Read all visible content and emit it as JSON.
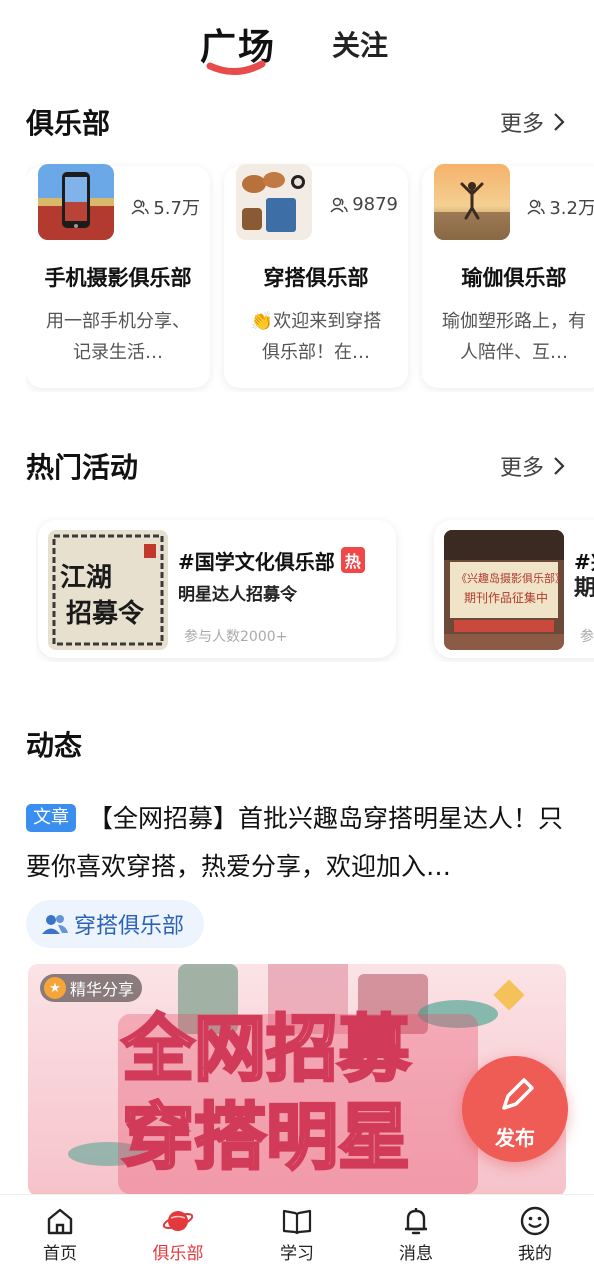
{
  "top_tabs": {
    "active": "广场",
    "other": "关注"
  },
  "clubs_section": {
    "title": "俱乐部",
    "more_label": "更多",
    "cards": [
      {
        "name": "手机摄影俱乐部",
        "members": "5.7万",
        "desc": "用一部手机分享、记录生活…",
        "thumb_icon": "phone-camera-thumb"
      },
      {
        "name": "穿搭俱乐部",
        "members": "9879",
        "desc": "👏欢迎来到穿搭俱乐部！在…",
        "thumb_icon": "fashion-items-thumb"
      },
      {
        "name": "瑜伽俱乐部",
        "members": "3.2万",
        "desc": "瑜伽塑形路上，有人陪伴、互…",
        "thumb_icon": "yoga-sunset-thumb"
      }
    ]
  },
  "activities_section": {
    "title": "热门活动",
    "more_label": "更多",
    "cards": [
      {
        "title": "#国学文化俱乐部",
        "hot_badge": "热",
        "subtitle": "明星达人招募令",
        "participants": "参与人数2000+",
        "thumb_text": "江湖招募令"
      },
      {
        "title": "#兴",
        "hot_badge": "",
        "subtitle": "期",
        "participants": "参",
        "thumb_text": "《兴趣岛摄影俱乐部》期刊作品征集中"
      }
    ]
  },
  "feed_section": {
    "title": "动态",
    "post": {
      "type_tag": "文章",
      "text": "【全网招募】首批兴趣岛穿搭明星达人！只要你喜欢穿搭，热爱分享，欢迎加入…",
      "club_chip": "穿搭俱乐部",
      "featured_badge": "精华分享",
      "banner_line1": "全网招募",
      "banner_line2": "穿搭明星"
    }
  },
  "fab": {
    "label": "发布"
  },
  "bottom_nav": {
    "items": [
      {
        "label": "首页",
        "icon": "home-icon",
        "active": false
      },
      {
        "label": "俱乐部",
        "icon": "planet-icon",
        "active": true
      },
      {
        "label": "学习",
        "icon": "book-icon",
        "active": false
      },
      {
        "label": "消息",
        "icon": "bell-icon",
        "active": false
      },
      {
        "label": "我的",
        "icon": "smiley-face-icon",
        "active": false
      }
    ]
  },
  "colors": {
    "accent_red": "#e4393c",
    "article_blue": "#3a8ef0",
    "chip_bg": "#eef4fd",
    "fab_red": "#ef5b55"
  }
}
